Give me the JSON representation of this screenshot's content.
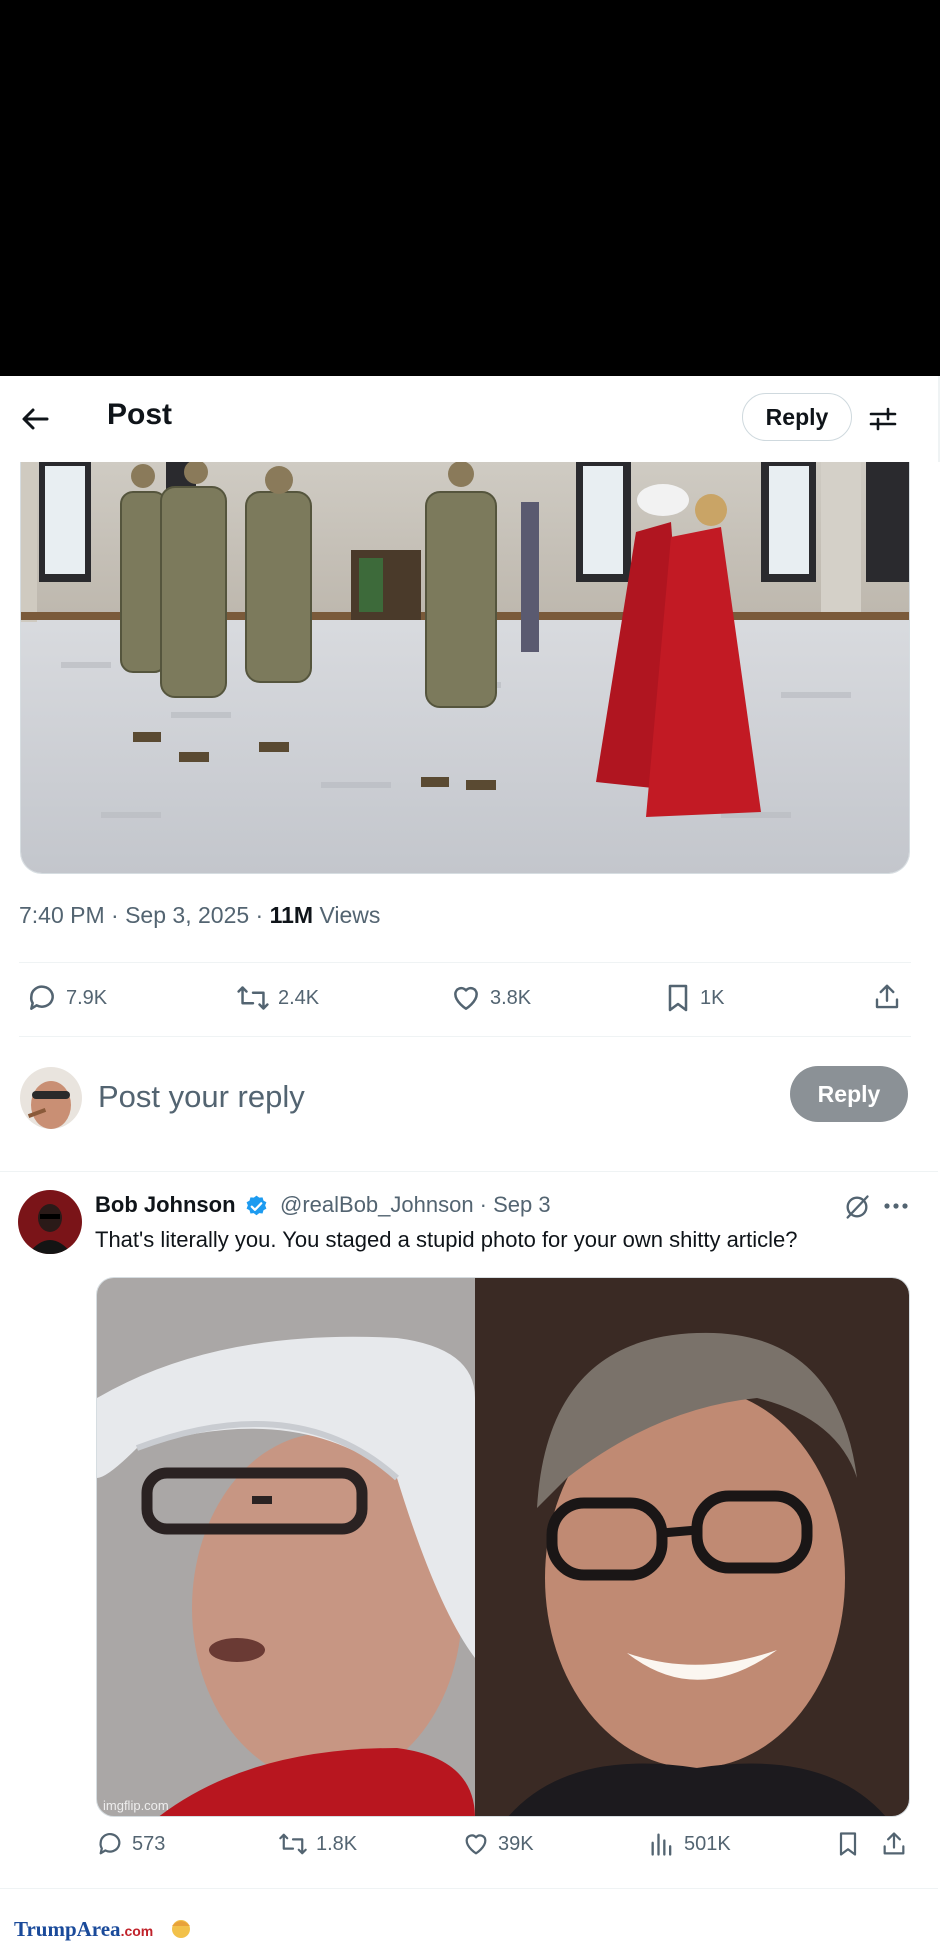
{
  "header": {
    "title": "Post",
    "reply_label": "Reply"
  },
  "post": {
    "time": "7:40 PM · Sep 3, 2025 · ",
    "views_count": "11M",
    "views_label": " Views",
    "actions": {
      "replies": "7.9K",
      "reposts": "2.4K",
      "likes": "3.8K",
      "bookmarks": "1K"
    }
  },
  "composer": {
    "placeholder": "Post your reply",
    "button_label": "Reply"
  },
  "reply": {
    "name": "Bob Johnson",
    "handle": "@realBob_Johnson · Sep 3",
    "text": "That's literally you. You staged a stupid photo for your own shitty article?",
    "watermark": "imgflip.com",
    "actions": {
      "replies": "573",
      "reposts": "1.8K",
      "likes": "39K",
      "views": "501K"
    }
  },
  "footer": {
    "brand": "TrumpArea",
    "suffix": ".com"
  },
  "colors": {
    "text": "#0f1419",
    "muted": "#536471",
    "verified": "#1d9bf0",
    "reply_button": "#8b9196",
    "brand_blue": "#1a4a9a"
  },
  "icons": [
    "back-arrow-icon",
    "settings-sliders-icon",
    "comment-icon",
    "repost-icon",
    "heart-icon",
    "bookmark-icon",
    "share-icon",
    "verified-badge-icon",
    "grok-icon",
    "more-icon",
    "views-bar-icon"
  ]
}
